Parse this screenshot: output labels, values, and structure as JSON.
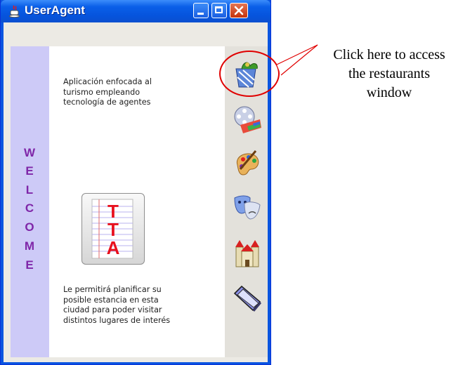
{
  "window": {
    "title": "UserAgent"
  },
  "welcome": {
    "letters": [
      "W",
      "E",
      "L",
      "C",
      "O",
      "M",
      "E"
    ],
    "color": "#7f26a8"
  },
  "content": {
    "intro": [
      "Aplicación enfocada al",
      "turismo empleando",
      "tecnología de agentes"
    ],
    "logo_letters": [
      "T",
      "T",
      "A"
    ],
    "outro": [
      "Le permitirá planificar su",
      "posible estancia en esta",
      "ciudad para poder visitar",
      "distintos lugares de interés"
    ]
  },
  "sidebar": {
    "icons": [
      "restaurants-icon",
      "cinema-film-icon",
      "art-palette-icon",
      "theater-masks-icon",
      "castle-monuments-icon",
      "book-icon"
    ]
  },
  "callout": {
    "lines": [
      "Click here to access",
      "the restaurants",
      "window"
    ],
    "color": "#e00000"
  }
}
